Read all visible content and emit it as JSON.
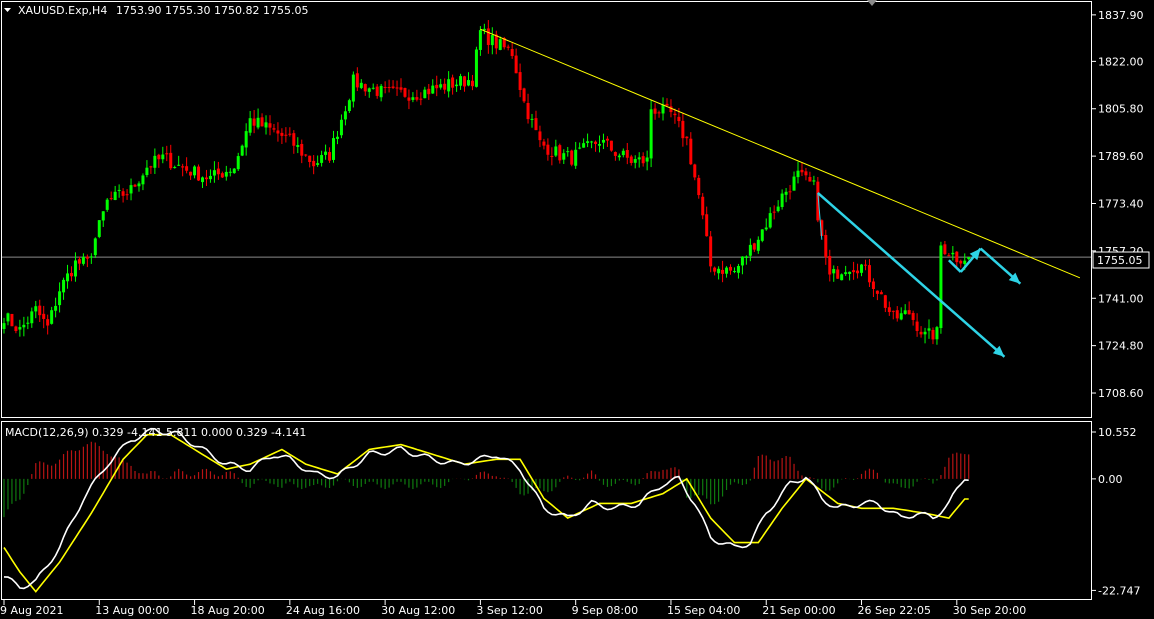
{
  "window": {
    "symbol_label": "XAUUSD.Exp,H4",
    "ohlc_label": "1753.90 1755.30 1750.82 1755.05",
    "current_price_label": "1755.05",
    "partial_price_label": "1757.20"
  },
  "macd_panel": {
    "label": "MACD(12,26,9) 0.329 -4.141 5.811 0.000 0.329 -4.141"
  },
  "colors": {
    "background": "#000000",
    "bull_candle": "#00ff00",
    "bear_candle": "#ff0000",
    "grid_text": "#ffffff",
    "trendline": "#ffff00",
    "arrow": "#2ed3e6",
    "macd_line": "#ffffff",
    "signal_line": "#ffff00",
    "hist_positive": "#b81414",
    "hist_negative": "#0f7a0f"
  },
  "chart_data": [
    {
      "type": "candlestick",
      "symbol": "XAUUSD.Exp",
      "timeframe": "H4",
      "ylim": [
        1700.4,
        1842.3
      ],
      "yticks": [
        "1837.90",
        "1822.00",
        "1805.80",
        "1789.60",
        "1773.40",
        "1757.20",
        "1741.00",
        "1724.80",
        "1708.60"
      ],
      "xticks": [
        {
          "label": "9 Aug 2021",
          "index": 0
        },
        {
          "label": "13 Aug 00:00",
          "index": 24
        },
        {
          "label": "18 Aug 20:00",
          "index": 48
        },
        {
          "label": "24 Aug 16:00",
          "index": 72
        },
        {
          "label": "30 Aug 12:00",
          "index": 96
        },
        {
          "label": "3 Sep 12:00",
          "index": 120
        },
        {
          "label": "9 Sep 08:00",
          "index": 144
        },
        {
          "label": "15 Sep 04:00",
          "index": 168
        },
        {
          "label": "21 Sep 00:00",
          "index": 192
        },
        {
          "label": "26 Sep 22:05",
          "index": 216
        },
        {
          "label": "30 Sep 20:00",
          "index": 240
        }
      ],
      "current_price": 1755.05,
      "anchors": [
        {
          "i": 0,
          "p": 1735
        },
        {
          "i": 4,
          "p": 1730
        },
        {
          "i": 8,
          "p": 1737
        },
        {
          "i": 11,
          "p": 1731
        },
        {
          "i": 14,
          "p": 1744
        },
        {
          "i": 18,
          "p": 1753
        },
        {
          "i": 21,
          "p": 1753
        },
        {
          "i": 26,
          "p": 1774
        },
        {
          "i": 32,
          "p": 1778
        },
        {
          "i": 36,
          "p": 1786
        },
        {
          "i": 40,
          "p": 1789
        },
        {
          "i": 46,
          "p": 1785
        },
        {
          "i": 52,
          "p": 1782
        },
        {
          "i": 58,
          "p": 1786
        },
        {
          "i": 62,
          "p": 1802
        },
        {
          "i": 68,
          "p": 1798
        },
        {
          "i": 72,
          "p": 1795
        },
        {
          "i": 78,
          "p": 1787
        },
        {
          "i": 82,
          "p": 1790
        },
        {
          "i": 88,
          "p": 1815
        },
        {
          "i": 96,
          "p": 1811
        },
        {
          "i": 104,
          "p": 1811
        },
        {
          "i": 112,
          "p": 1814
        },
        {
          "i": 118,
          "p": 1816
        },
        {
          "i": 120,
          "p": 1832
        },
        {
          "i": 124,
          "p": 1828
        },
        {
          "i": 128,
          "p": 1825
        },
        {
          "i": 131,
          "p": 1808
        },
        {
          "i": 135,
          "p": 1794
        },
        {
          "i": 140,
          "p": 1790
        },
        {
          "i": 143,
          "p": 1789
        },
        {
          "i": 150,
          "p": 1795
        },
        {
          "i": 154,
          "p": 1791
        },
        {
          "i": 158,
          "p": 1788
        },
        {
          "i": 162,
          "p": 1788
        },
        {
          "i": 163,
          "p": 1806
        },
        {
          "i": 168,
          "p": 1804
        },
        {
          "i": 172,
          "p": 1795
        },
        {
          "i": 175,
          "p": 1776
        },
        {
          "i": 178,
          "p": 1752
        },
        {
          "i": 184,
          "p": 1750
        },
        {
          "i": 190,
          "p": 1762
        },
        {
          "i": 196,
          "p": 1776
        },
        {
          "i": 200,
          "p": 1783
        },
        {
          "i": 204,
          "p": 1779
        },
        {
          "i": 206,
          "p": 1761
        },
        {
          "i": 208,
          "p": 1748
        },
        {
          "i": 212,
          "p": 1752
        },
        {
          "i": 216,
          "p": 1752
        },
        {
          "i": 220,
          "p": 1744
        },
        {
          "i": 224,
          "p": 1734
        },
        {
          "i": 228,
          "p": 1736
        },
        {
          "i": 232,
          "p": 1728
        },
        {
          "i": 235,
          "p": 1729
        },
        {
          "i": 236,
          "p": 1759
        },
        {
          "i": 240,
          "p": 1755
        }
      ],
      "annotations": {
        "trendline": {
          "from": {
            "i": 120,
            "p": 1833
          },
          "to": {
            "i": 271,
            "p": 1748
          }
        },
        "down_channel_arrow": {
          "from": {
            "i": 205,
            "p": 1777
          },
          "to": {
            "i": 252,
            "p": 1721
          }
        },
        "forecast_arrow": [
          {
            "i": 238,
            "p": 1754
          },
          {
            "i": 241,
            "p": 1750
          },
          {
            "i": 246,
            "p": 1758
          },
          {
            "i": 256,
            "p": 1746
          }
        ]
      }
    },
    {
      "type": "macd",
      "params": "12,26,9",
      "ylim": [
        -24.5,
        11.6
      ],
      "yticks": [
        "10.552",
        "0.00",
        "-22.747"
      ],
      "macd_anchors": [
        {
          "i": 0,
          "v": -20
        },
        {
          "i": 4,
          "v": -22
        },
        {
          "i": 8,
          "v": -21
        },
        {
          "i": 14,
          "v": -14
        },
        {
          "i": 20,
          "v": -4
        },
        {
          "i": 26,
          "v": 3
        },
        {
          "i": 32,
          "v": 8
        },
        {
          "i": 38,
          "v": 10
        },
        {
          "i": 44,
          "v": 9
        },
        {
          "i": 50,
          "v": 6
        },
        {
          "i": 56,
          "v": 3
        },
        {
          "i": 62,
          "v": 2
        },
        {
          "i": 68,
          "v": 5
        },
        {
          "i": 72,
          "v": 4
        },
        {
          "i": 78,
          "v": 1
        },
        {
          "i": 84,
          "v": 0.5
        },
        {
          "i": 92,
          "v": 5
        },
        {
          "i": 100,
          "v": 6
        },
        {
          "i": 108,
          "v": 4
        },
        {
          "i": 114,
          "v": 3
        },
        {
          "i": 120,
          "v": 4
        },
        {
          "i": 124,
          "v": 5
        },
        {
          "i": 130,
          "v": 2
        },
        {
          "i": 136,
          "v": -6
        },
        {
          "i": 142,
          "v": -8
        },
        {
          "i": 148,
          "v": -5
        },
        {
          "i": 154,
          "v": -6
        },
        {
          "i": 160,
          "v": -5
        },
        {
          "i": 166,
          "v": -1
        },
        {
          "i": 170,
          "v": 0
        },
        {
          "i": 174,
          "v": -5
        },
        {
          "i": 178,
          "v": -12
        },
        {
          "i": 184,
          "v": -14
        },
        {
          "i": 188,
          "v": -13
        },
        {
          "i": 192,
          "v": -7
        },
        {
          "i": 198,
          "v": -1
        },
        {
          "i": 202,
          "v": 0.5
        },
        {
          "i": 206,
          "v": -4
        },
        {
          "i": 210,
          "v": -6
        },
        {
          "i": 216,
          "v": -5
        },
        {
          "i": 220,
          "v": -5
        },
        {
          "i": 226,
          "v": -8
        },
        {
          "i": 230,
          "v": -7
        },
        {
          "i": 234,
          "v": -8
        },
        {
          "i": 238,
          "v": -5
        },
        {
          "i": 242,
          "v": 0.3
        }
      ],
      "signal_anchors": [
        {
          "i": 0,
          "v": -14
        },
        {
          "i": 4,
          "v": -19
        },
        {
          "i": 8,
          "v": -23
        },
        {
          "i": 14,
          "v": -17
        },
        {
          "i": 22,
          "v": -7
        },
        {
          "i": 30,
          "v": 4
        },
        {
          "i": 36,
          "v": 9
        },
        {
          "i": 42,
          "v": 9
        },
        {
          "i": 50,
          "v": 5
        },
        {
          "i": 56,
          "v": 2
        },
        {
          "i": 62,
          "v": 3
        },
        {
          "i": 70,
          "v": 6
        },
        {
          "i": 76,
          "v": 3
        },
        {
          "i": 84,
          "v": 1
        },
        {
          "i": 92,
          "v": 6
        },
        {
          "i": 100,
          "v": 7
        },
        {
          "i": 108,
          "v": 5
        },
        {
          "i": 116,
          "v": 3
        },
        {
          "i": 124,
          "v": 4
        },
        {
          "i": 130,
          "v": 4
        },
        {
          "i": 136,
          "v": -4
        },
        {
          "i": 142,
          "v": -8
        },
        {
          "i": 150,
          "v": -5
        },
        {
          "i": 158,
          "v": -5
        },
        {
          "i": 166,
          "v": -3
        },
        {
          "i": 172,
          "v": 0
        },
        {
          "i": 178,
          "v": -8
        },
        {
          "i": 184,
          "v": -13
        },
        {
          "i": 190,
          "v": -13
        },
        {
          "i": 196,
          "v": -6
        },
        {
          "i": 202,
          "v": 0
        },
        {
          "i": 210,
          "v": -5
        },
        {
          "i": 216,
          "v": -6
        },
        {
          "i": 224,
          "v": -6
        },
        {
          "i": 232,
          "v": -7
        },
        {
          "i": 238,
          "v": -8
        },
        {
          "i": 242,
          "v": -4.1
        }
      ]
    }
  ]
}
